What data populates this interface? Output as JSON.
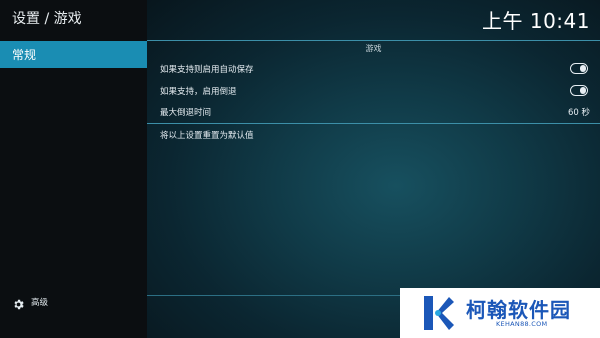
{
  "header": {
    "title": "设置 / 游戏",
    "clock": "上午 10:41"
  },
  "sidebar": {
    "items": [
      {
        "label": "常规",
        "selected": true
      }
    ],
    "footer_label": "高级",
    "footer_icon": "gear-icon"
  },
  "main": {
    "section_title": "游戏",
    "settings": [
      {
        "label": "如果支持则启用自动保存",
        "type": "toggle",
        "state": true
      },
      {
        "label": "如果支持，启用倒退",
        "type": "toggle",
        "state": true
      },
      {
        "label": "最大倒退时间",
        "type": "value",
        "value": "60 秒"
      }
    ],
    "reset_label": "将以上设置重置为默认值"
  },
  "watermark": {
    "name": "柯翰软件园",
    "domain": "KEHAN88.COM"
  },
  "colors": {
    "accent": "#1a8db3",
    "divider": "#3c8fa8",
    "watermark_blue": "#1b57b8"
  }
}
